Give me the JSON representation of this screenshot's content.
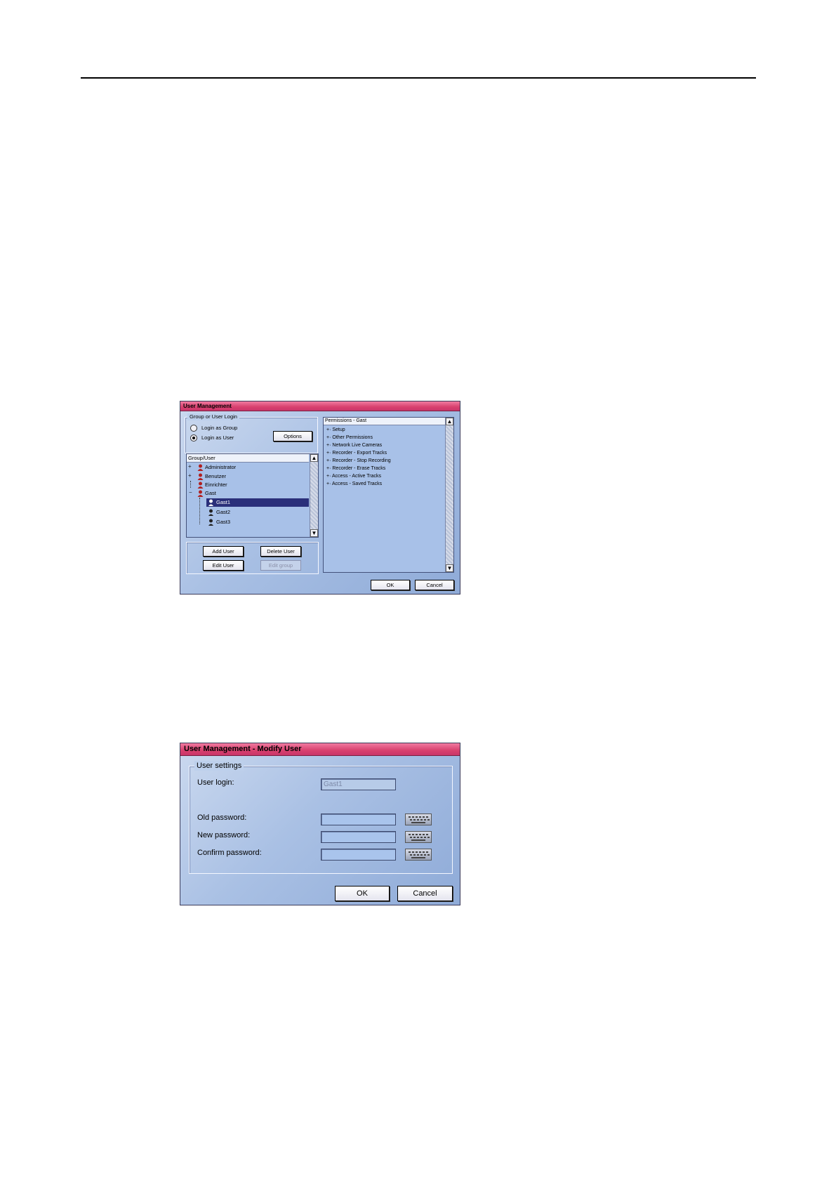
{
  "dialog1": {
    "title": "User Management",
    "login_group": {
      "legend": "Group or User Login",
      "radio_group_label": "Login as Group",
      "radio_user_label": "Login as User",
      "selected": "user",
      "options_button": "Options"
    },
    "tree": {
      "header": "Group/User",
      "items": [
        {
          "label": "Administrator",
          "expander": "+",
          "type": "group"
        },
        {
          "label": "Benutzer",
          "expander": "+",
          "type": "group"
        },
        {
          "label": "Einrichter",
          "expander": "",
          "type": "group"
        },
        {
          "label": "Gast",
          "expander": "−",
          "type": "group"
        },
        {
          "label": "Gast1",
          "expander": "",
          "type": "user",
          "selected": true
        },
        {
          "label": "Gast2",
          "expander": "",
          "type": "user"
        },
        {
          "label": "Gast3",
          "expander": "",
          "type": "user"
        }
      ]
    },
    "buttons": {
      "add_user": "Add User",
      "delete_user": "Delete User",
      "edit_user": "Edit User",
      "edit_group": "Edit group"
    },
    "permissions": {
      "header": "Permissions - Gast",
      "items": [
        "Setup",
        "Other Permissions",
        "Network Live Cameras",
        "Recorder - Export Tracks",
        "Recorder - Stop Recording",
        "Recorder - Erase Tracks",
        "Access - Active Tracks",
        "Access - Saved Tracks"
      ]
    },
    "ok": "OK",
    "cancel": "Cancel"
  },
  "dialog2": {
    "title": "User Management - Modify User",
    "legend": "User settings",
    "user_login_label": "User login:",
    "user_login_value": "Gast1",
    "old_password_label": "Old password:",
    "new_password_label": "New password:",
    "confirm_password_label": "Confirm password:",
    "ok": "OK",
    "cancel": "Cancel"
  },
  "icons": [
    "keyboard-icon",
    "user-group-icon",
    "user-icon"
  ],
  "colors": {
    "title_bar": "#d8406e",
    "dialog_bg": "#a9c0e4",
    "selection": "#2a2f7a"
  }
}
